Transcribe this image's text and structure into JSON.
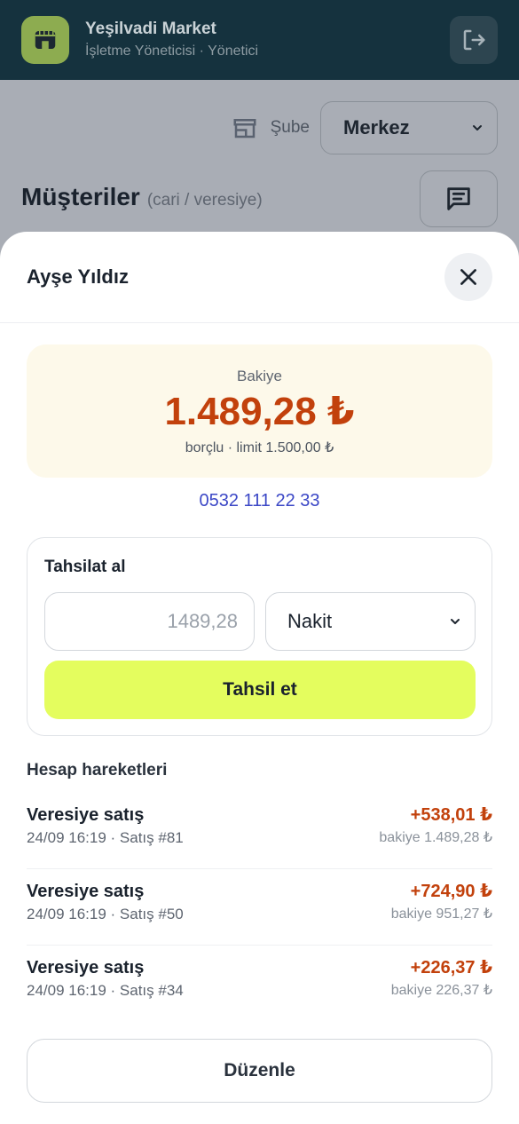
{
  "app": {
    "name": "Yeşilvadi Market",
    "role": "İşletme Yöneticisi · Yönetici"
  },
  "branch": {
    "label": "Şube",
    "selected": "Merkez"
  },
  "page": {
    "title": "Müşteriler",
    "subtitle": "(cari / veresiye)"
  },
  "sheet": {
    "title": "Ayşe Yıldız",
    "balance_label": "Bakiye",
    "balance_amount": "1.489,28 ₺",
    "balance_note": "borçlu · limit 1.500,00 ₺",
    "phone": "0532 111 22 33"
  },
  "collect": {
    "title": "Tahsilat al",
    "amount_placeholder": "1489,28",
    "method_selected": "Nakit",
    "button_label": "Tahsil et"
  },
  "history": {
    "title": "Hesap hareketleri",
    "rows": [
      {
        "title": "Veresiye satış",
        "meta": "24/09 16:19 · Satış #81",
        "amount": "+538,01 ₺",
        "balance": "bakiye 1.489,28 ₺"
      },
      {
        "title": "Veresiye satış",
        "meta": "24/09 16:19 · Satış #50",
        "amount": "+724,90 ₺",
        "balance": "bakiye 951,27 ₺"
      },
      {
        "title": "Veresiye satış",
        "meta": "24/09 16:19 · Satış #34",
        "amount": "+226,37 ₺",
        "balance": "bakiye 226,37 ₺"
      }
    ]
  },
  "actions": {
    "edit_label": "Düzenle"
  },
  "colors": {
    "appbar": "#15323e",
    "accent_lime": "#e4fd5e",
    "debt_orange": "#c2410c",
    "link_blue": "#3b47c6"
  },
  "icons": {
    "app_logo": "store-icon",
    "logout": "logout-icon",
    "branch": "store-icon",
    "chat": "message-icon",
    "close": "close-icon",
    "dropdown": "chevron-down-icon"
  }
}
